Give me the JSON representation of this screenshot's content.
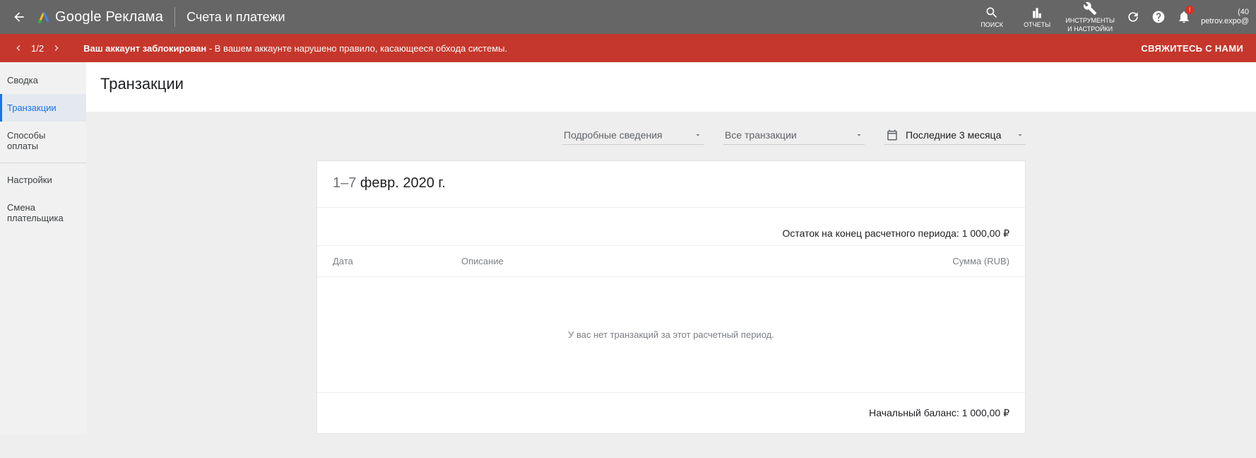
{
  "appbar": {
    "product": "Google Реклама",
    "title": "Счета и платежи",
    "tools": {
      "search": "ПОИСК",
      "reports": "ОТЧЕТЫ",
      "toolssettings_l1": "ИНСТРУМЕНТЫ",
      "toolssettings_l2": "И НАСТРОЙКИ"
    },
    "bell_badge": "!",
    "account_line1": "(40",
    "account_line2": "petrov.expo@"
  },
  "alert": {
    "counter": "1/2",
    "strong": "Ваш аккаунт заблокирован",
    "rest": " - В вашем аккаунте нарушено правило, касающееся обхода системы.",
    "cta": "СВЯЖИТЕСЬ С НАМИ"
  },
  "sidebar": {
    "items": [
      "Сводка",
      "Транзакции",
      "Способы оплаты",
      "Настройки",
      "Смена плательщика"
    ],
    "active_index": 1
  },
  "heading": "Транзакции",
  "filters": {
    "view": "Подробные сведения",
    "type": "Все транзакции",
    "range": "Последние 3 месяца"
  },
  "card": {
    "range_pre": "1–7",
    "range_rest": " февр. 2020 г.",
    "balance_label": "Остаток на конец расчетного периода: 1 000,00 ₽",
    "col_date": "Дата",
    "col_desc": "Описание",
    "col_amt": "Сумма (RUB)",
    "empty": "У вас нет транзакций за этот расчетный период.",
    "foot": "Начальный баланс: 1 000,00 ₽"
  }
}
